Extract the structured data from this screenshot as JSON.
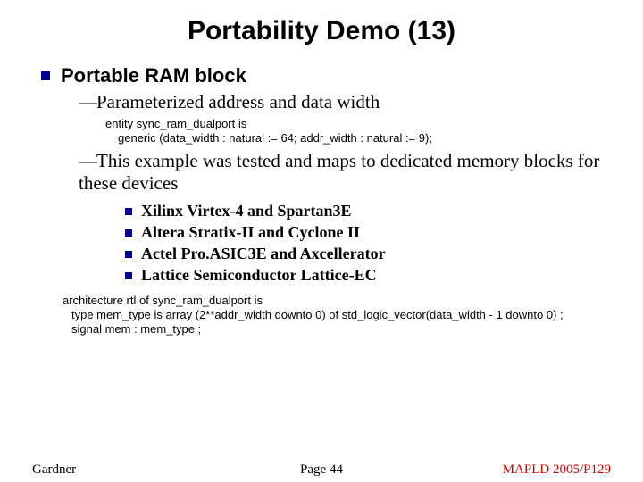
{
  "title": "Portability Demo (13)",
  "heading": "Portable RAM block",
  "sub1": "Parameterized address and data width",
  "code1_line1": "entity sync_ram_dualport is",
  "code1_line2": "generic (data_width : natural := 64;  addr_width : natural := 9);",
  "sub2": "This example was tested and maps to dedicated memory blocks for these devices",
  "devices": [
    "Xilinx Virtex-4 and Spartan3E",
    "Altera Stratix-II and Cyclone II",
    "Actel Pro.ASIC3E and Axcellerator",
    "Lattice Semiconductor Lattice-EC"
  ],
  "arch_line1": "architecture rtl of sync_ram_dualport is",
  "arch_line2": "type mem_type is array (2**addr_width downto 0) of  std_logic_vector(data_width - 1 downto 0) ;",
  "arch_line3": "signal mem : mem_type ;",
  "footer": {
    "left": "Gardner",
    "center": "Page 44",
    "right": "MAPLD 2005/P129"
  }
}
